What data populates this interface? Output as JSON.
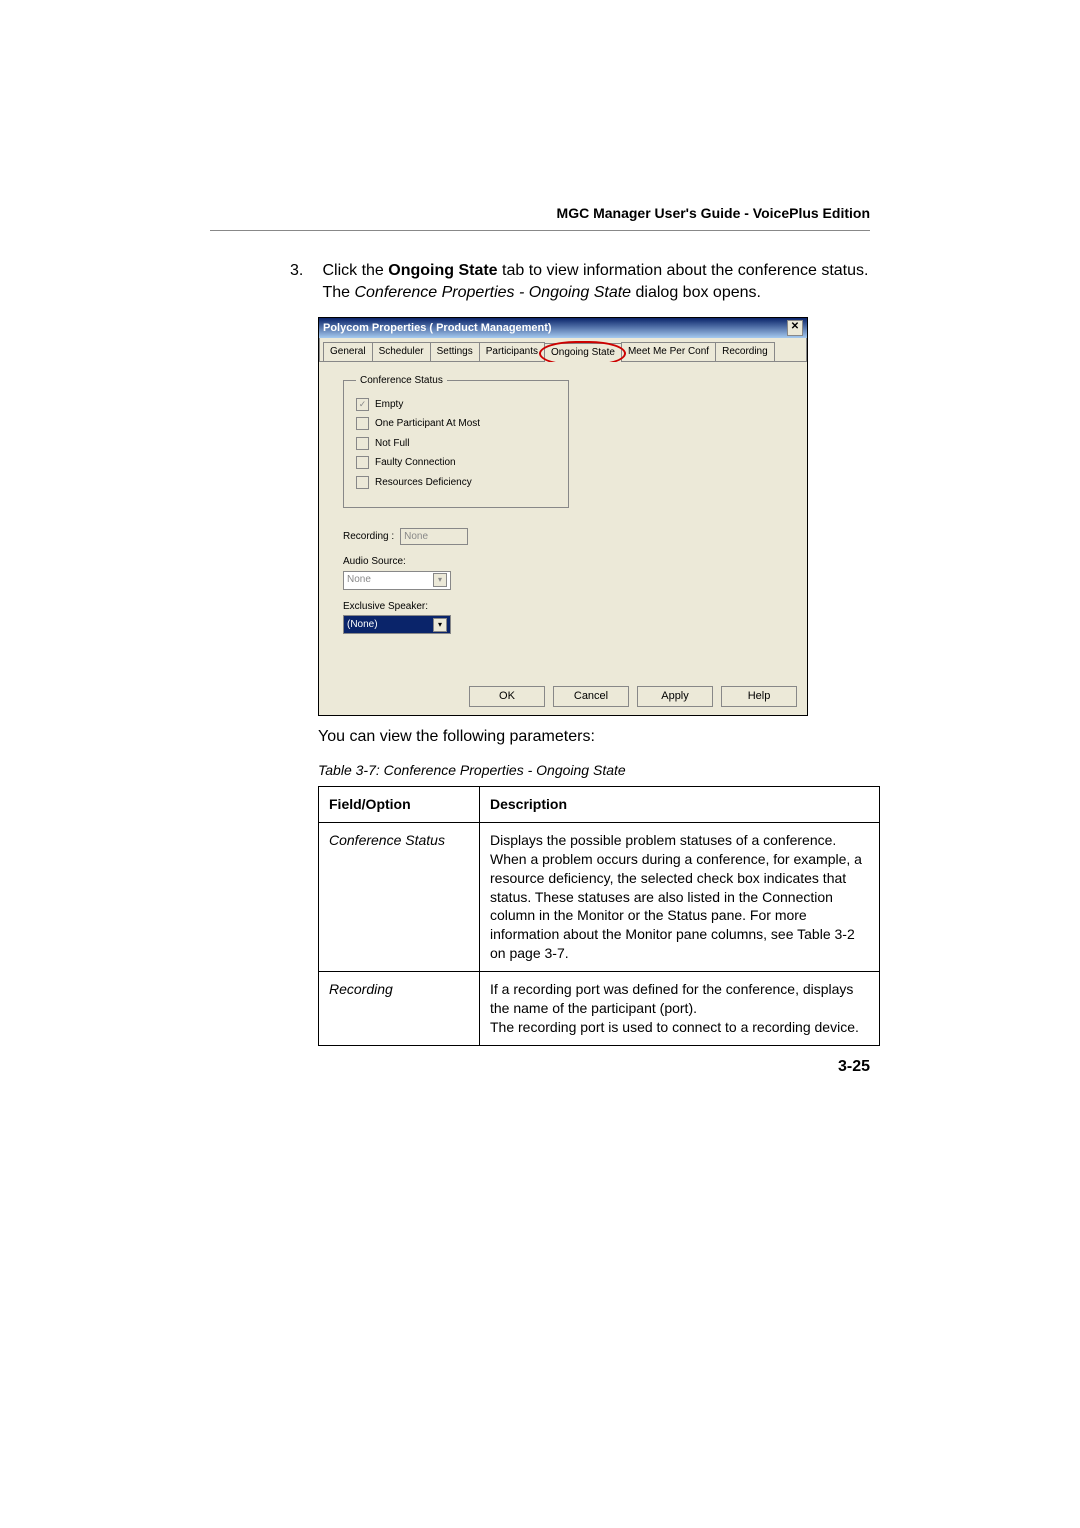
{
  "header": "MGC Manager User's Guide - VoicePlus Edition",
  "step": {
    "num": "3.",
    "line1_a": "Click the ",
    "line1_b": "Ongoing State",
    "line1_c": " tab to view information about the conference status.",
    "line2_a": "The ",
    "line2_b": "Conference Properties - Ongoing State",
    "line2_c": " dialog box opens."
  },
  "dialog": {
    "title": "Polycom Properties ( Product Management)",
    "tabs": [
      "General",
      "Scheduler",
      "Settings",
      "Participants",
      "Ongoing State",
      "Meet Me Per Conf",
      "Recording"
    ],
    "group_title": "Conference Status",
    "checks": [
      {
        "label": "Empty",
        "checked": true
      },
      {
        "label": "One Participant At Most",
        "checked": false
      },
      {
        "label": "Not Full",
        "checked": false
      },
      {
        "label": "Faulty Connection",
        "checked": false
      },
      {
        "label": "Resources Deficiency",
        "checked": false
      }
    ],
    "recording_label": "Recording :",
    "recording_value": "None",
    "audio_label": "Audio Source:",
    "audio_value": "None",
    "speaker_label": "Exclusive Speaker:",
    "speaker_value": "(None)",
    "buttons": {
      "ok": "OK",
      "cancel": "Cancel",
      "apply": "Apply",
      "help": "Help"
    }
  },
  "after_dialog": "You can view the following parameters:",
  "table": {
    "caption": "Table 3-7: Conference Properties - Ongoing State",
    "head": {
      "c1": "Field/Option",
      "c2": "Description"
    },
    "rows": [
      {
        "field": "Conference Status",
        "desc": "Displays the possible problem statuses of a conference. When a problem occurs during a conference, for example, a resource deficiency, the selected check box indicates that status. These statuses are also listed in the Connection column in the Monitor or the Status pane. For more information about the Monitor pane columns, see Table 3-2 on page 3-7."
      },
      {
        "field": "Recording",
        "desc": "If a recording port was defined for the conference, displays the name of the participant (port).\nThe recording port is used to connect to a recording device."
      }
    ]
  },
  "pagenum": "3-25"
}
